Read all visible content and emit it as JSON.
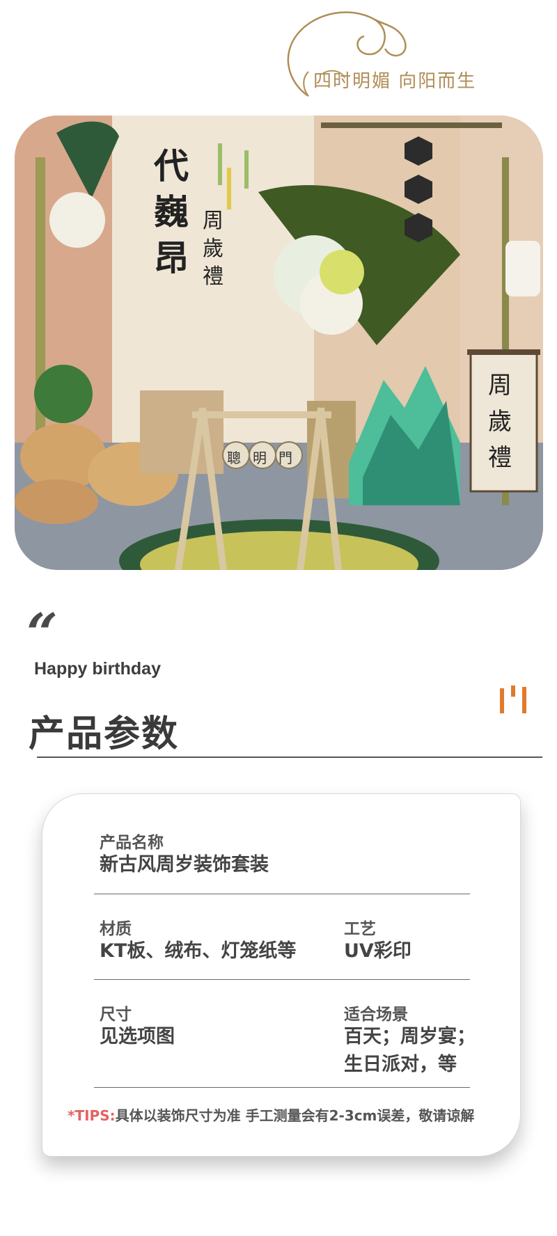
{
  "brand": {
    "slogan": "四时明媚  向阳而生"
  },
  "hero_photo": {
    "main_name_chars": [
      "代",
      "巍",
      "昂"
    ],
    "ceremony_chars": [
      "周",
      "歲",
      "禮"
    ],
    "swing_sign_chars": [
      "聰",
      "明",
      "門"
    ],
    "scroll_chars": [
      "周",
      "歲",
      "禮"
    ]
  },
  "section": {
    "quote_mark": "“",
    "eyebrow": "Happy birthday",
    "title": "产品参数"
  },
  "specs": {
    "name_label": "产品名称",
    "name_value": "新古风周岁装饰套装",
    "material_label": "材质",
    "material_value": "KT板、绒布、灯笼纸等",
    "craft_label": "工艺",
    "craft_value": "UV彩印",
    "size_label": "尺寸",
    "size_value": "见选项图",
    "scene_label": "适合场景",
    "scene_value_line1": "百天；周岁宴；",
    "scene_value_line2": "生日派对，等",
    "tips_tag": "*TIPS:",
    "tips_text": "具体以装饰尺寸为准 手工测量会有2-3cm误差，敬请谅解"
  },
  "colors": {
    "gold": "#b08d57",
    "accent_orange": "#e07a2c",
    "tips_red": "#e26464",
    "text_dark": "#3a3a3a"
  }
}
